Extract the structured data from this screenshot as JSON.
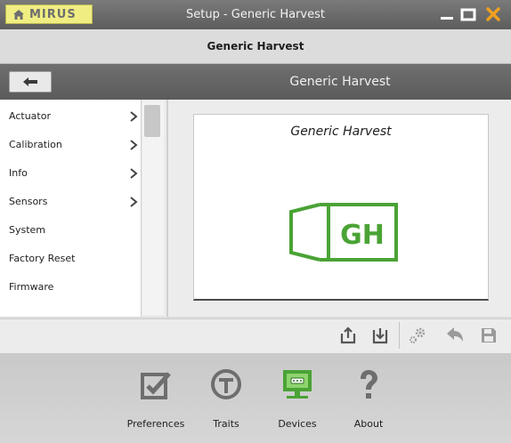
{
  "window": {
    "title": "Setup - Generic Harvest",
    "brand": "MIRUS"
  },
  "header": {
    "page_title": "Generic Harvest"
  },
  "nav": {
    "title": "Generic Harvest"
  },
  "sidebar": {
    "items": [
      {
        "label": "Actuator",
        "has_chevron": true
      },
      {
        "label": "Calibration",
        "has_chevron": true
      },
      {
        "label": "Info",
        "has_chevron": true
      },
      {
        "label": "Sensors",
        "has_chevron": true
      },
      {
        "label": "System",
        "has_chevron": false
      },
      {
        "label": "Factory Reset",
        "has_chevron": false
      },
      {
        "label": "Firmware",
        "has_chevron": false
      }
    ]
  },
  "preview": {
    "name": "Generic Harvest",
    "logo_text": "GH",
    "logo_color": "#4aa335"
  },
  "toolbar": {
    "icons": [
      "export-icon",
      "import-icon",
      "settings-icon",
      "undo-icon",
      "save-icon"
    ]
  },
  "dock": {
    "items": [
      {
        "label": "Preferences",
        "icon": "checkbox-icon"
      },
      {
        "label": "Traits",
        "icon": "traits-icon"
      },
      {
        "label": "Devices",
        "icon": "devices-icon",
        "active": true
      },
      {
        "label": "About",
        "icon": "question-icon"
      }
    ]
  },
  "colors": {
    "accent_green": "#4aa335",
    "close_orange": "#f0a020",
    "home_yellow": "#f0ee82"
  }
}
